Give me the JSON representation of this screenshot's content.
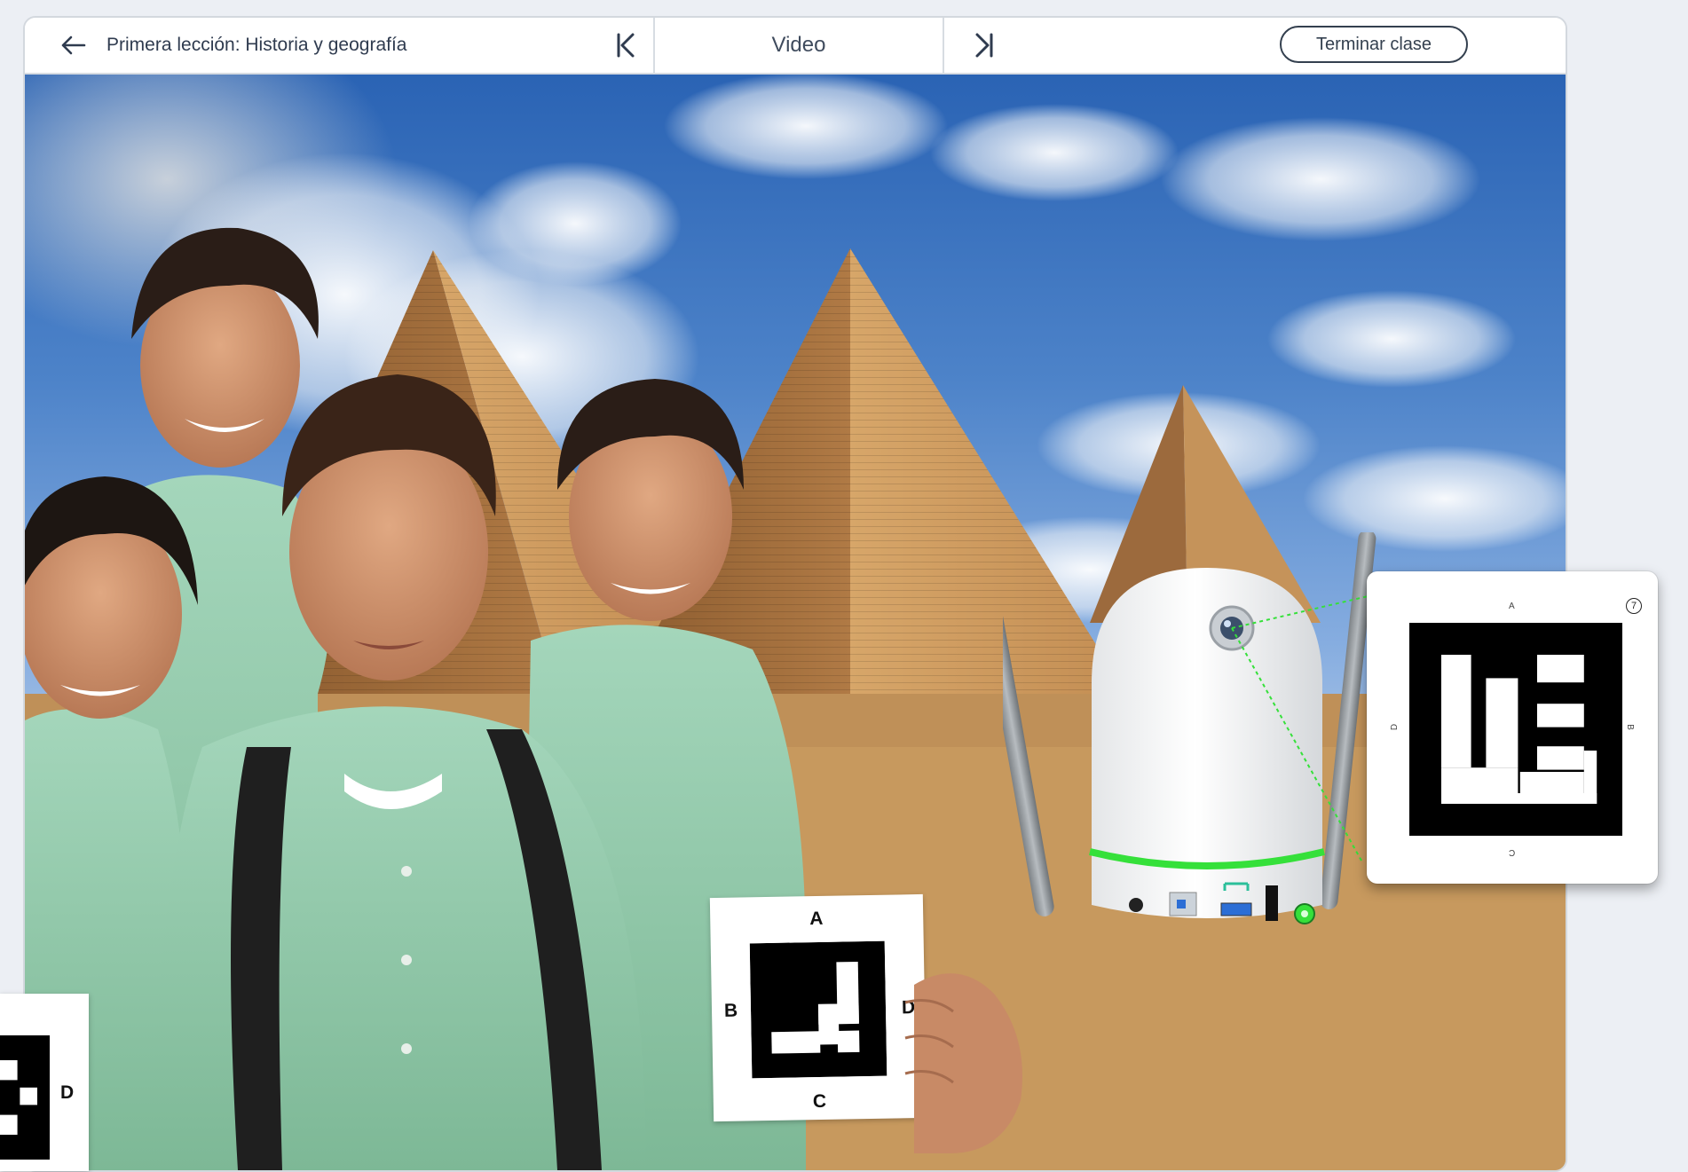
{
  "toolbar": {
    "lesson_title": "Primera lección: Historia y geografía",
    "section_label": "Video",
    "end_class_label": "Terminar clase",
    "icons": {
      "back": "arrow-left-icon",
      "previous": "skip-previous-icon",
      "next": "skip-next-icon"
    }
  },
  "marker_card": {
    "label_a": "A",
    "label_b": "B",
    "label_c": "C",
    "label_d": "D",
    "number": "7"
  },
  "student_card_right": {
    "label_a": "A",
    "label_b": "B",
    "label_c": "C",
    "label_d": "D"
  },
  "student_card_left": {
    "label_d": "D"
  },
  "colors": {
    "toolbar_text": "#2f3b4f",
    "accent_green": "#35e03a",
    "sky_blue": "#3b73c0",
    "shirt_green": "#8fc7a8",
    "sand": "#c99a60"
  }
}
